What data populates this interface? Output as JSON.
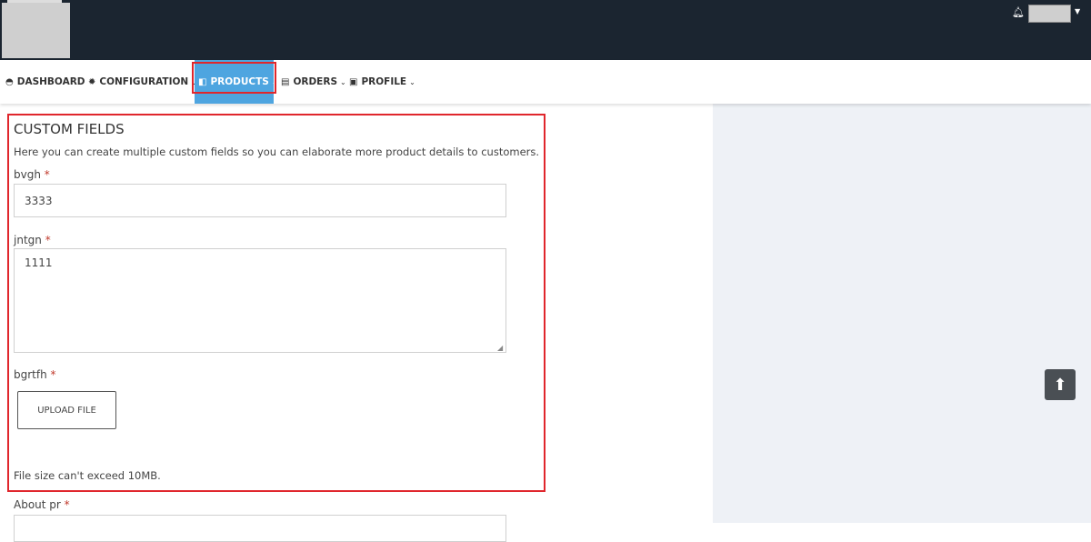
{
  "header": {
    "notifications_icon": "bell-icon",
    "user_menu_caret": "caret-down-icon"
  },
  "nav": {
    "items": [
      {
        "label": "DASHBOARD",
        "icon": "dashboard-icon"
      },
      {
        "label": "CONFIGURATION",
        "icon": "gear-icon"
      },
      {
        "label": "PRODUCTS",
        "icon": "box-icon",
        "active": true
      },
      {
        "label": "ORDERS",
        "icon": "clipboard-icon"
      },
      {
        "label": "PROFILE",
        "icon": "id-card-icon"
      }
    ]
  },
  "custom_fields": {
    "title": "CUSTOM FIELDS",
    "description": "Here you can create multiple custom fields so you can elaborate more product details to customers.",
    "fields": [
      {
        "label": "bvgh",
        "required": "*",
        "value": "3333"
      },
      {
        "label": "jntgn",
        "required": "*",
        "value": "1111"
      },
      {
        "label": "bgrtfh",
        "required": "*",
        "button": "UPLOAD FILE"
      }
    ],
    "file_note": "File size can't exceed 10MB."
  },
  "about": {
    "label": "About pr",
    "required": "*"
  },
  "colors": {
    "header": "#1b2530",
    "accent": "#4ea5e0",
    "highlight": "#e0262c"
  }
}
